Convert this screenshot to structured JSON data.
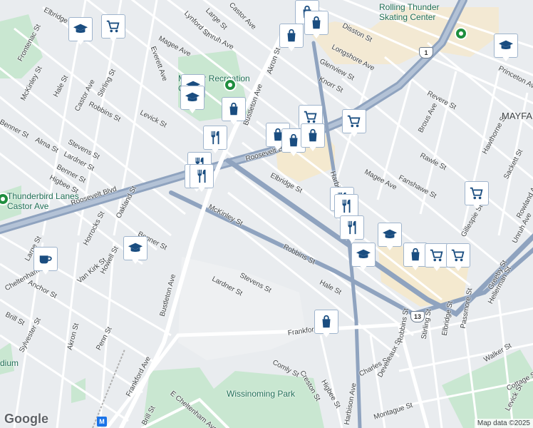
{
  "map": {
    "attribution": "Map data ©2025",
    "logo": "Google",
    "colors": {
      "background": "#e9ecef",
      "street": "#ffffff",
      "arterial": "#8fa3bf",
      "park": "#c9e7d1",
      "commercial": "#f4e9cf",
      "marker_icon": "#1a4d80"
    },
    "street_labels": [
      {
        "text": "Elbridge St"
      },
      {
        "text": "Frontenac St"
      },
      {
        "text": "McKinley St"
      },
      {
        "text": "Hale St"
      },
      {
        "text": "Castor Ave"
      },
      {
        "text": "Stirling St"
      },
      {
        "text": "Robbins St"
      },
      {
        "text": "Levick St"
      },
      {
        "text": "Everett Ave"
      },
      {
        "text": "Magee Ave"
      },
      {
        "text": "Unruh Ave"
      },
      {
        "text": "Akron St"
      },
      {
        "text": "Bustleton Ave"
      },
      {
        "text": "Disston St"
      },
      {
        "text": "Longshore Ave"
      },
      {
        "text": "Glenview St"
      },
      {
        "text": "Knorr St"
      },
      {
        "text": "Roosevelt Blvd"
      },
      {
        "text": "Brous Ave"
      },
      {
        "text": "Princeton Ave"
      },
      {
        "text": "Revere St"
      },
      {
        "text": "Hawthorne St"
      },
      {
        "text": "Rawle St"
      },
      {
        "text": "Fanshawe St"
      },
      {
        "text": "Sackett St"
      },
      {
        "text": "Elbridge St"
      },
      {
        "text": "Harbison Ave"
      },
      {
        "text": "Magee Ave"
      },
      {
        "text": "Gillespie St"
      },
      {
        "text": "Rowland Ave"
      },
      {
        "text": "Benner St"
      },
      {
        "text": "Alma St"
      },
      {
        "text": "Stevens St"
      },
      {
        "text": "Lardner St"
      },
      {
        "text": "Benner St"
      },
      {
        "text": "Higbee St"
      },
      {
        "text": "Roosevelt Blvd"
      },
      {
        "text": "Oakland St"
      },
      {
        "text": "Benner St"
      },
      {
        "text": "Horrocks St"
      },
      {
        "text": "Howell St"
      },
      {
        "text": "Van Kirk St"
      },
      {
        "text": "Large St"
      },
      {
        "text": "Cheltenham Ave"
      },
      {
        "text": "Anchor St"
      },
      {
        "text": "Brill St"
      },
      {
        "text": "Akron St"
      },
      {
        "text": "Sylvester St"
      },
      {
        "text": "Penn St"
      },
      {
        "text": "Bustleton Ave"
      },
      {
        "text": "McKinley St"
      },
      {
        "text": "Stevens St"
      },
      {
        "text": "Lardner St"
      },
      {
        "text": "Robbins St"
      },
      {
        "text": "Hale St"
      },
      {
        "text": "Frankford Ave"
      },
      {
        "text": "Comly St"
      },
      {
        "text": "Creston St"
      },
      {
        "text": "Higbee St"
      },
      {
        "text": "Harbison Ave"
      },
      {
        "text": "Charles St"
      },
      {
        "text": "Devereaux St"
      },
      {
        "text": "Robbins St"
      },
      {
        "text": "Stirling St"
      },
      {
        "text": "Passmore St"
      },
      {
        "text": "Elbridge St"
      },
      {
        "text": "Hellerman St"
      },
      {
        "text": "Greeby St"
      },
      {
        "text": "Walker St"
      },
      {
        "text": "Cottage St"
      },
      {
        "text": "Levick St"
      },
      {
        "text": "Montague St"
      },
      {
        "text": "Frankford Ave"
      },
      {
        "text": "E Cheltenham Ave"
      },
      {
        "text": "Brill St"
      },
      {
        "text": "Unruh Ave"
      },
      {
        "text": "Lynford St"
      },
      {
        "text": "Large St"
      },
      {
        "text": "Castor Ave"
      }
    ],
    "places": [
      {
        "text": "Rolling Thunder Skating Center",
        "icon": "park-pin-icon"
      },
      {
        "text": "MAYFAIR",
        "icon": ""
      },
      {
        "text": "Mayfair Recreation Center",
        "icon": "park-pin-icon"
      },
      {
        "text": "Thunderbird Lanes Castor Ave",
        "icon": "park-pin-icon"
      },
      {
        "text": "Wissinoming Park",
        "icon": ""
      },
      {
        "text": "dium",
        "icon": ""
      }
    ],
    "shields": [
      {
        "text": "1"
      },
      {
        "text": "13"
      }
    ],
    "markers": [
      {
        "icon": "shopping-bag-icon"
      },
      {
        "icon": "shopping-bag-icon"
      },
      {
        "icon": "shopping-bag-icon"
      },
      {
        "icon": "graduation-cap-icon"
      },
      {
        "icon": "shopping-cart-icon"
      },
      {
        "icon": "graduation-cap-icon"
      },
      {
        "icon": "graduation-cap-icon"
      },
      {
        "icon": "shopping-bag-icon"
      },
      {
        "icon": "shopping-cart-icon"
      },
      {
        "icon": "shopping-bag-icon"
      },
      {
        "icon": "shopping-bag-icon"
      },
      {
        "icon": "shopping-bag-icon"
      },
      {
        "icon": "shopping-cart-icon"
      },
      {
        "icon": "fork-knife-icon"
      },
      {
        "icon": "fork-knife-icon"
      },
      {
        "icon": "fork-knife-icon"
      },
      {
        "icon": "fork-knife-icon"
      },
      {
        "icon": "shopping-cart-icon"
      },
      {
        "icon": "fork-knife-icon"
      },
      {
        "icon": "fork-knife-icon"
      },
      {
        "icon": "fork-knife-icon"
      },
      {
        "icon": "graduation-cap-icon"
      },
      {
        "icon": "graduation-cap-icon"
      },
      {
        "icon": "shopping-bag-icon"
      },
      {
        "icon": "shopping-cart-icon"
      },
      {
        "icon": "shopping-cart-icon"
      },
      {
        "icon": "graduation-cap-icon"
      },
      {
        "icon": "graduation-cap-icon"
      },
      {
        "icon": "coffee-cup-icon"
      },
      {
        "icon": "shopping-bag-icon"
      }
    ]
  }
}
